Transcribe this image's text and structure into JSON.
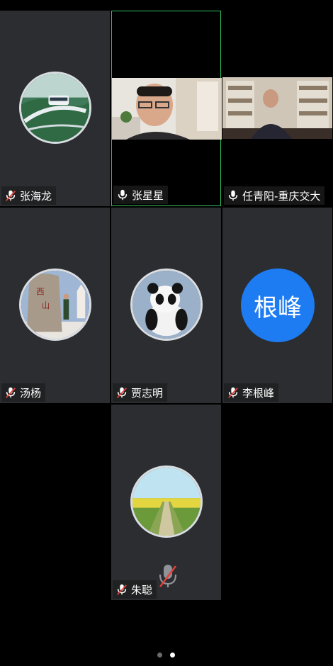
{
  "participants": [
    {
      "name": "张海龙",
      "muted": true,
      "avatar": "train-photo"
    },
    {
      "name": "张星星",
      "muted": false,
      "video": true,
      "active_speaker": true
    },
    {
      "name": "任青阳-重庆交大",
      "muted": false,
      "video": true
    },
    {
      "name": "汤杨",
      "muted": true,
      "avatar": "stone-monument-photo"
    },
    {
      "name": "贾志明",
      "muted": true,
      "avatar": "panda-photo"
    },
    {
      "name": "李根峰",
      "muted": true,
      "avatar_text": "根峰",
      "avatar_color": "#1e7cf2"
    },
    {
      "name": "朱聪",
      "muted": true,
      "avatar": "field-road-photo"
    }
  ],
  "pager": {
    "total": 2,
    "current": 2
  },
  "colors": {
    "tile_bg": "#2b2d30",
    "active_border": "#2fbf5a",
    "mute_red": "#e0403a"
  }
}
